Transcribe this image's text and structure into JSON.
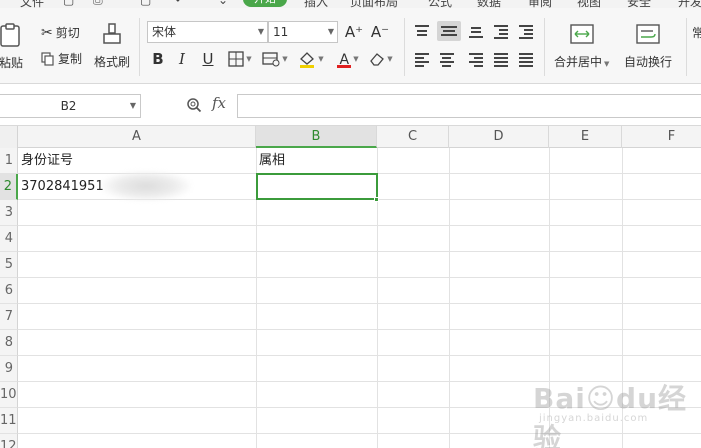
{
  "menu": {
    "items": [
      "文件",
      "开始",
      "插入",
      "页面布局",
      "公式",
      "数据",
      "审阅",
      "视图",
      "安全",
      "开发"
    ],
    "active": "开始"
  },
  "ribbon": {
    "paste_label": "粘贴",
    "cut_label": "剪切",
    "copy_label": "复制",
    "format_painter_label": "格式刷",
    "font_name": "宋体",
    "font_size": "11",
    "increase_font": "A⁺",
    "decrease_font": "A⁻",
    "bold": "B",
    "italic": "I",
    "underline": "U",
    "font_color_glyph": "A",
    "merge_center_label": "合并居中",
    "wrap_text_label": "自动换行",
    "partial_label": "常",
    "colors": {
      "font_color_bar": "#e02020",
      "fill_color_bar": "#f0d000",
      "accent": "#4aa74a"
    }
  },
  "formula_bar": {
    "name_box": "B2",
    "fx": "fx",
    "formula_value": ""
  },
  "grid": {
    "columns": [
      "A",
      "B",
      "C",
      "D",
      "E",
      "F"
    ],
    "selected_column": "B",
    "rows": [
      "1",
      "2",
      "3",
      "4",
      "5",
      "6",
      "7",
      "8",
      "9",
      "10",
      "11",
      "12"
    ],
    "selected_row": "2",
    "cells": {
      "A1": "身份证号",
      "B1": "属相",
      "A2": "3702841951"
    },
    "active_cell": "B2"
  },
  "watermark": {
    "logo": "Bai☺du经验",
    "sub": "jingyan.baidu.com"
  }
}
